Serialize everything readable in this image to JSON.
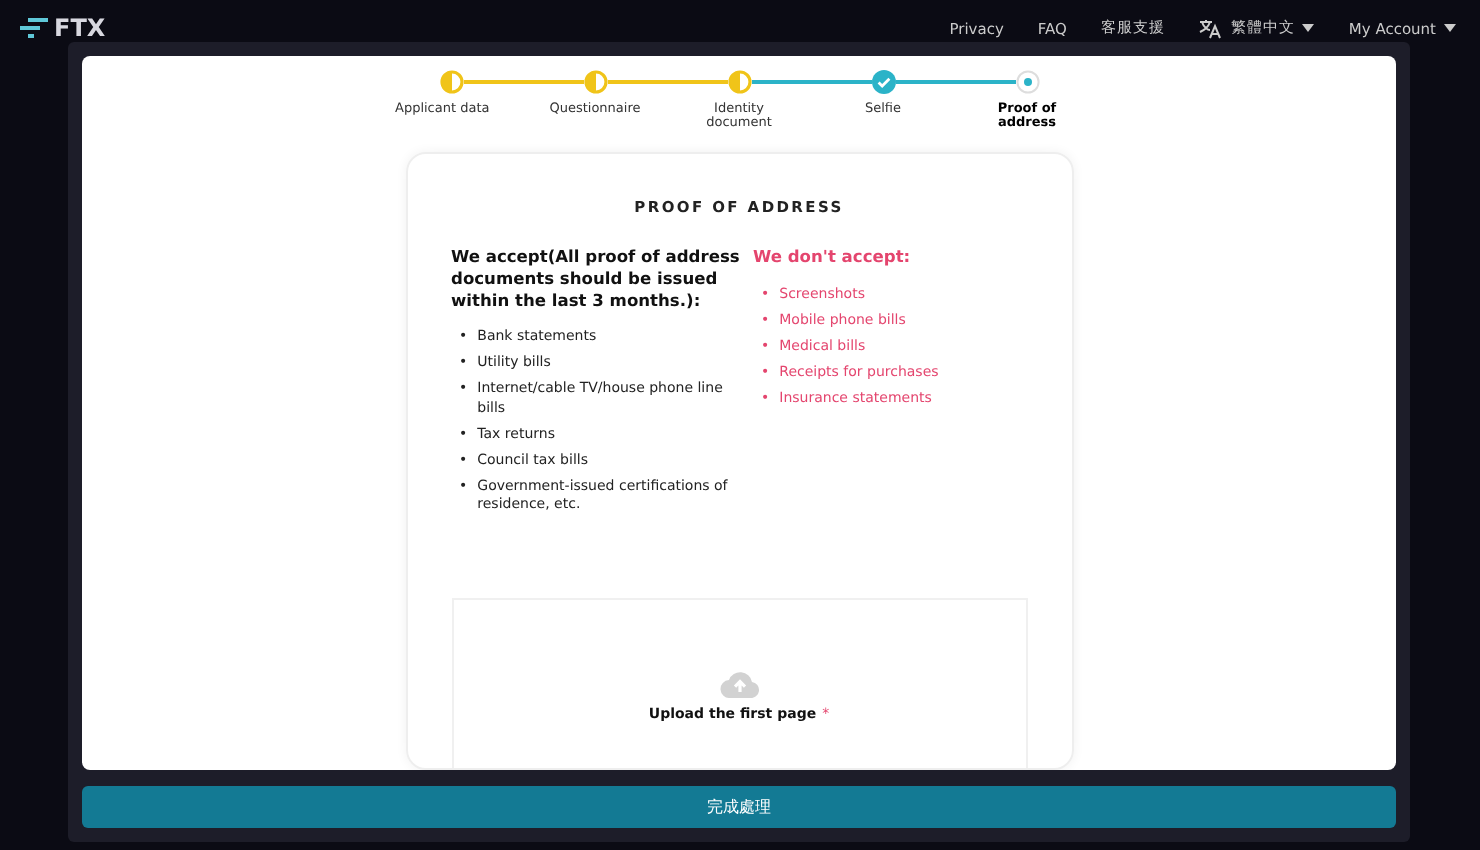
{
  "nav": {
    "logo": "FTX",
    "links": [
      "Privacy",
      "FAQ",
      "客服支援"
    ],
    "language": "繁體中文",
    "account": "My Account"
  },
  "steps": [
    {
      "label": "Applicant data",
      "kind": "partial"
    },
    {
      "label": "Questionnaire",
      "kind": "partial"
    },
    {
      "label": "Identity document",
      "kind": "partial"
    },
    {
      "label": "Selfie",
      "kind": "done"
    },
    {
      "label": "Proof of address",
      "kind": "current"
    }
  ],
  "card": {
    "title": "PROOF OF ADDRESS",
    "accept": {
      "marker": "•",
      "heading": "We accept(All proof of address documents should be issued within the last 3 months.):",
      "items": [
        "Bank statements",
        "Utility bills",
        "Internet/cable TV/house phone line bills",
        "Tax returns",
        "Council tax bills",
        "Government-issued certifications of residence, etc."
      ]
    },
    "reject": {
      "marker": "•",
      "heading": "We don't accept:",
      "items": [
        "Screenshots",
        "Mobile phone bills",
        "Medical bills",
        "Receipts for purchases",
        "Insurance statements"
      ]
    },
    "upload": {
      "label": "Upload the first page",
      "required_mark": "*"
    }
  },
  "submit": "完成處理"
}
